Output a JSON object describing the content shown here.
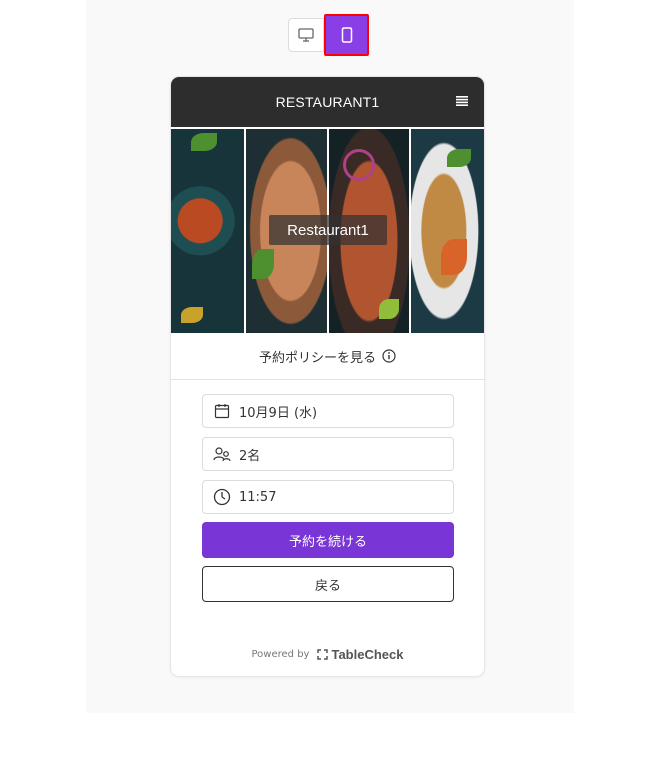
{
  "view_toggle": {
    "desktop_icon": "monitor-icon",
    "mobile_icon": "smartphone-icon",
    "active": "mobile",
    "accent_color": "#8a3fe6",
    "highlight_color": "#ff0000"
  },
  "header": {
    "brand": "RESTAURANT1",
    "menu_icon": "hamburger-menu-icon",
    "background": "#2d2d2d"
  },
  "hero": {
    "label": "Restaurant1"
  },
  "policy": {
    "label": "予約ポリシーを見る",
    "icon": "info-icon"
  },
  "form": {
    "date": {
      "icon": "calendar-icon",
      "value": "10月9日 (水)"
    },
    "party": {
      "icon": "people-icon",
      "value": "2名"
    },
    "time": {
      "icon": "clock-icon",
      "value": "11:57"
    },
    "continue_label": "予約を続ける",
    "back_label": "戻る",
    "primary_color": "#7a35d6"
  },
  "footer": {
    "powered_by": "Powered by",
    "brand": "TableCheck"
  }
}
